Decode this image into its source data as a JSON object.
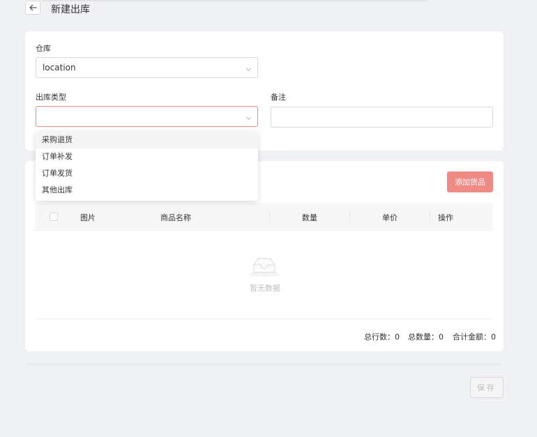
{
  "header": {
    "title": "新建出库"
  },
  "form": {
    "warehouse_label": "仓库",
    "warehouse_value": "location",
    "type_label": "出库类型",
    "type_value": "",
    "remark_label": "备注",
    "remark_value": ""
  },
  "dropdown": {
    "options": [
      "采购退货",
      "订单补发",
      "订单发货",
      "其他出库"
    ]
  },
  "goods": {
    "add_label": "添加货品",
    "columns": {
      "image": "图片",
      "name": "商品名称",
      "quantity": "数量",
      "price": "单价",
      "action": "操作"
    },
    "empty_text": "暂无数据",
    "summary": {
      "total_rows": "总行数：0",
      "total_quantity": "总数量：0",
      "total_amount": "合计金额：0"
    }
  },
  "footer": {
    "save_label": "保存"
  },
  "colors": {
    "accent": "#ef8b84",
    "background": "#f0f1f5"
  },
  "icons": {
    "back": "arrow-left-icon",
    "dropdown": "chevron-down-icon",
    "empty": "inbox-icon"
  }
}
